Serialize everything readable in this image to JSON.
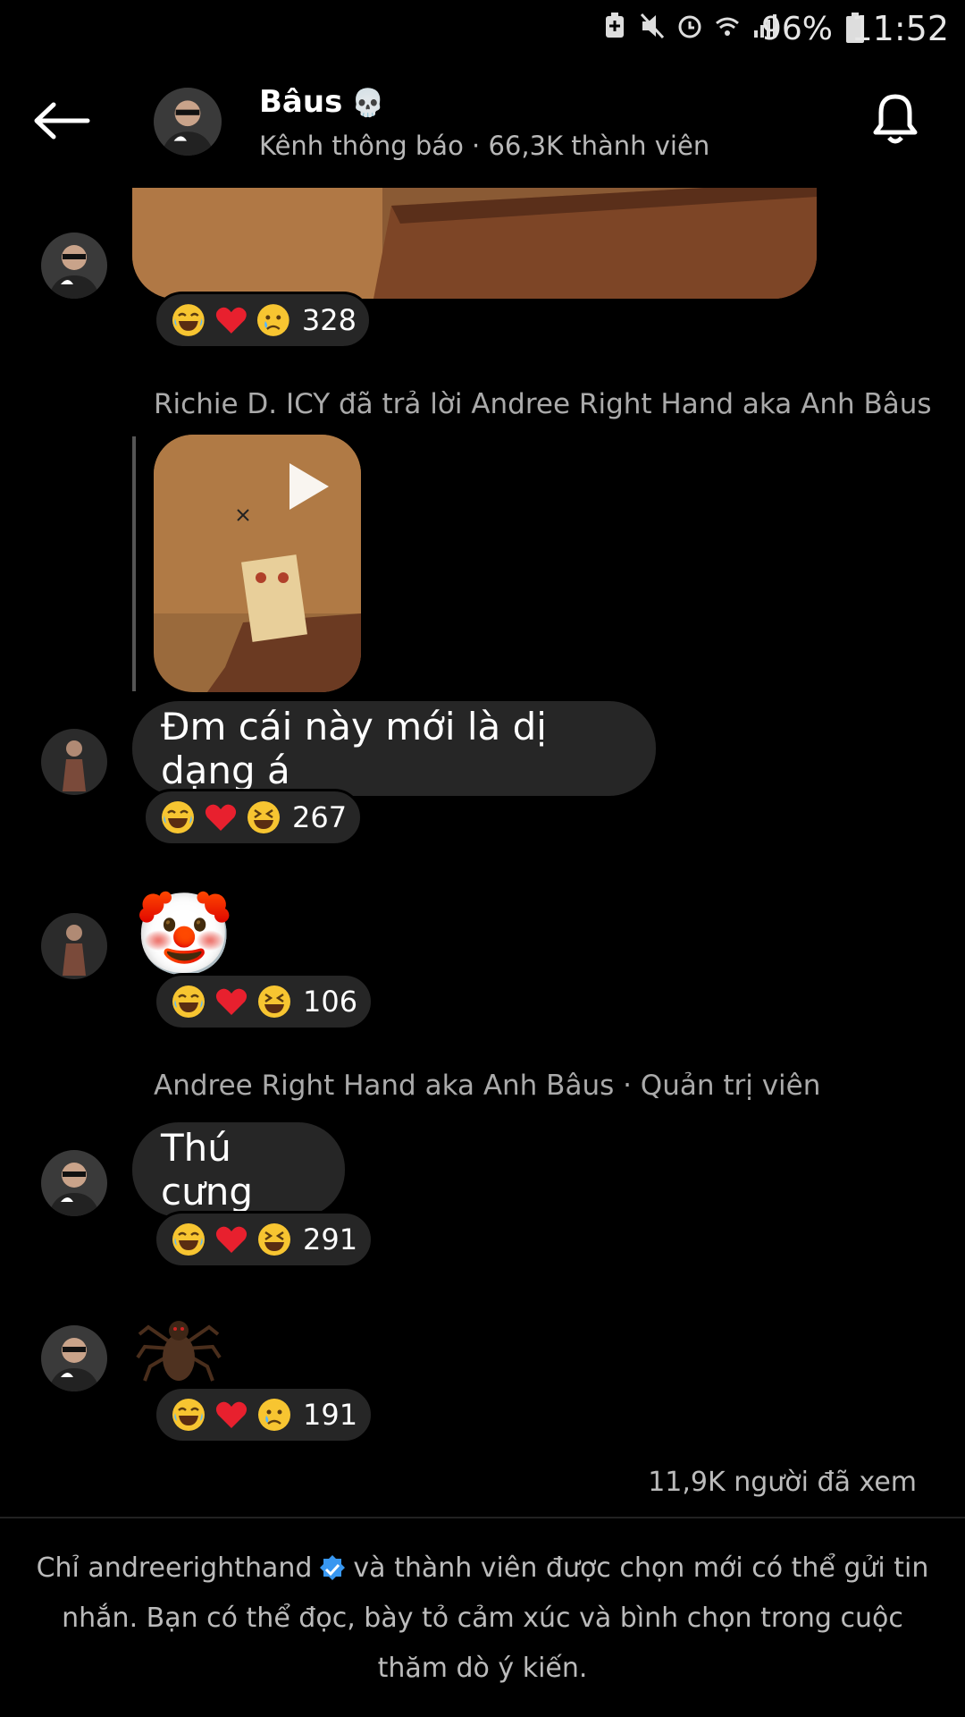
{
  "status": {
    "battery_pct": "96%",
    "time": "11:52"
  },
  "header": {
    "title": "Bâus",
    "subtitle": "Kênh thông báo · 66,3K thành viên"
  },
  "messages": [
    {
      "kind": "image-tail",
      "reactions": {
        "count": "328"
      }
    },
    {
      "kind": "reply-video",
      "meta": "Richie D. ICY đã trả lời Andree Right Hand aka Anh Bâus"
    },
    {
      "kind": "text",
      "text": "Đm cái này mới là dị dạng á",
      "reactions": {
        "count": "267"
      }
    },
    {
      "kind": "emoji",
      "text": "🤡",
      "reactions": {
        "count": "106"
      }
    },
    {
      "kind": "text",
      "meta": "Andree Right Hand aka Anh Bâus · Quản trị viên",
      "text": "Thú cưng",
      "reactions": {
        "count": "291"
      }
    },
    {
      "kind": "sticker",
      "sticker_name": "spider-sticker",
      "reactions": {
        "count": "191"
      }
    }
  ],
  "views": "11,9K người đã xem",
  "footer": {
    "pre": "Chỉ andreerighthand",
    "post": "và thành viên được chọn mới có thể gửi tin nhắn. Bạn có thể đọc, bày tỏ cảm xúc và bình chọn trong cuộc thăm dò ý kiến."
  }
}
